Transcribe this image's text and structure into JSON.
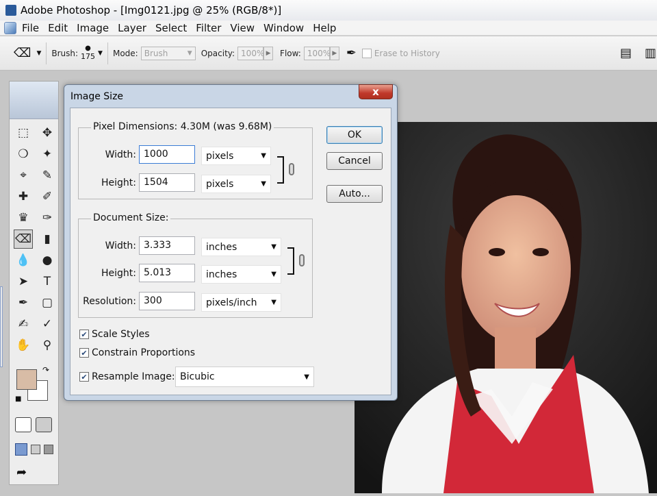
{
  "window": {
    "title": "Adobe Photoshop - [Img0121.jpg @ 25% (RGB/8*)]"
  },
  "menu": [
    "File",
    "Edit",
    "Image",
    "Layer",
    "Select",
    "Filter",
    "View",
    "Window",
    "Help"
  ],
  "options": {
    "brush_label": "Brush:",
    "brush_size": "175",
    "mode_label": "Mode:",
    "mode_value": "Brush",
    "opacity_label": "Opacity:",
    "opacity_value": "100%",
    "flow_label": "Flow:",
    "flow_value": "100%",
    "erase_history_label": "Erase to History"
  },
  "dialog": {
    "title": "Image Size",
    "close_label": "x",
    "pixel_dimensions": {
      "label": "Pixel Dimensions:",
      "summary": "4.30M (was 9.68M)",
      "width_label": "Width:",
      "width_value": "1000",
      "width_unit": "pixels",
      "height_label": "Height:",
      "height_value": "1504",
      "height_unit": "pixels"
    },
    "document_size": {
      "label": "Document Size:",
      "width_label": "Width:",
      "width_value": "3.333",
      "width_unit": "inches",
      "height_label": "Height:",
      "height_value": "5.013",
      "height_unit": "inches",
      "resolution_label": "Resolution:",
      "resolution_value": "300",
      "resolution_unit": "pixels/inch"
    },
    "buttons": {
      "ok": "OK",
      "cancel": "Cancel",
      "auto": "Auto..."
    },
    "checkboxes": {
      "scale_styles": "Scale Styles",
      "constrain_proportions": "Constrain Proportions",
      "resample_image": "Resample Image:"
    },
    "resample_method": "Bicubic"
  },
  "colors": {
    "foreground": "#d8bca6",
    "dialog_frame": "#c9d6e6",
    "close_button": "#c0392b"
  }
}
